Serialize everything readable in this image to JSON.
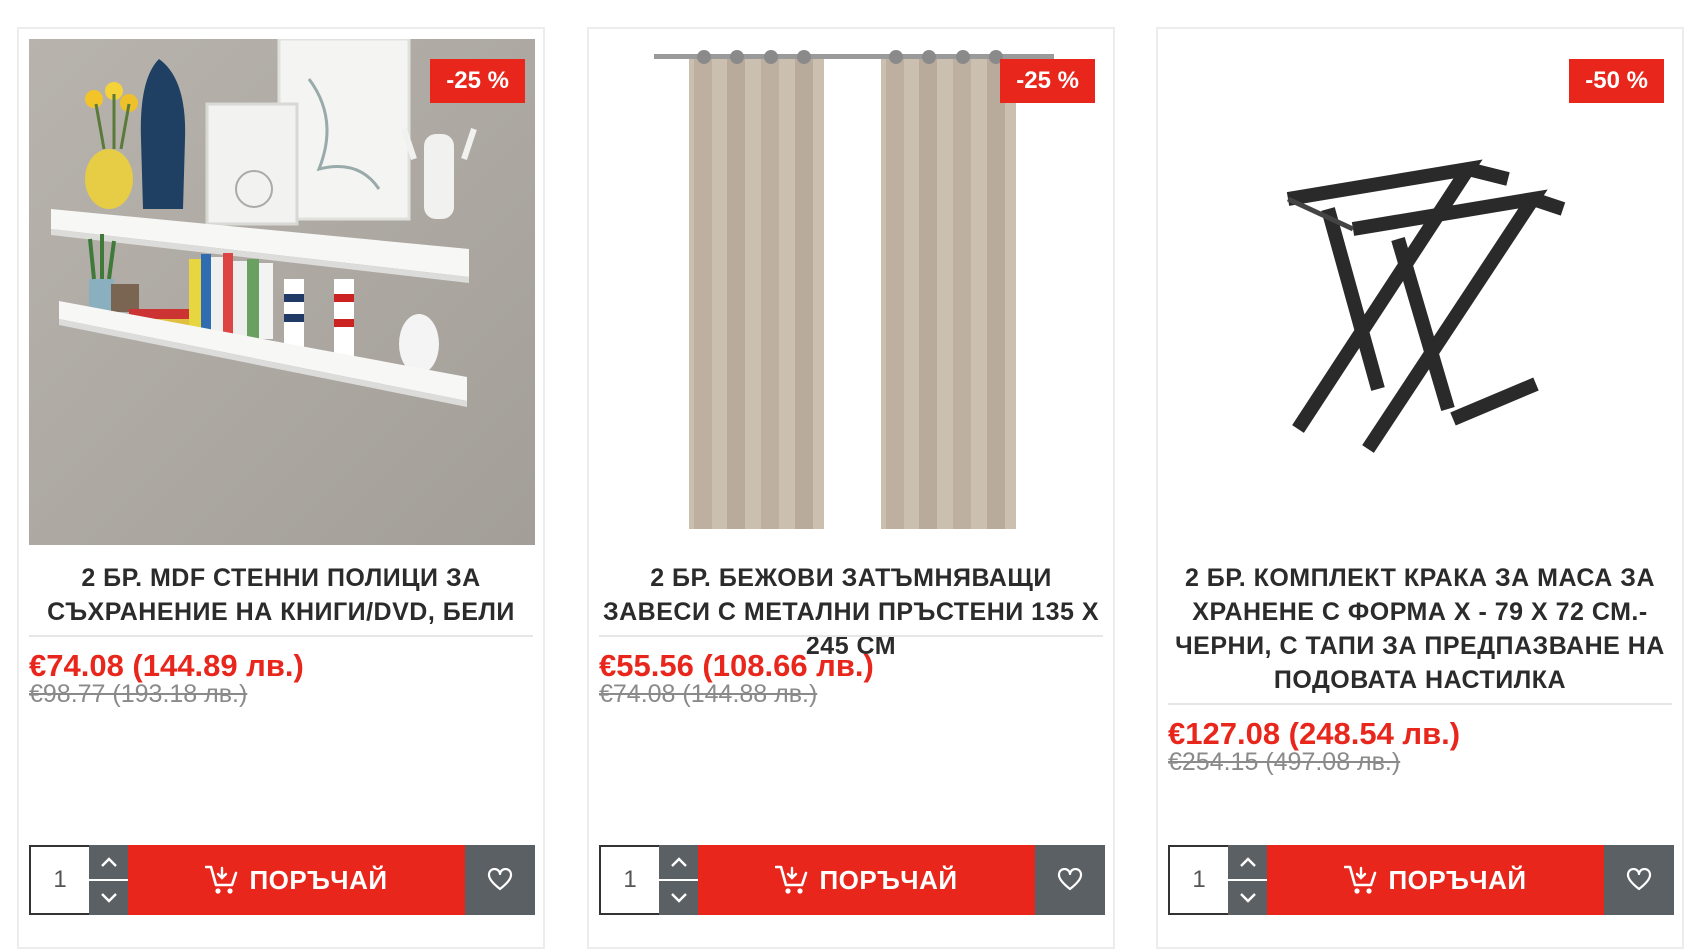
{
  "colors": {
    "accent": "#e8261c",
    "stepper": "#5b6064",
    "text": "#2b2b2b",
    "old_price": "#8a8a8a"
  },
  "products": [
    {
      "badge": "-25 %",
      "title": "2 бр. MDF стенни полици за съхранение на книги/DVD, бели",
      "price_new": "€74.08 (144.89 лв.)",
      "price_old": "€98.77 (193.18 лв.)",
      "quantity": "1",
      "order_label": "ПОРЪЧАЙ",
      "image_icon": "wall-shelves-image"
    },
    {
      "badge": "-25 %",
      "title": "2 бр. бежови затъмняващи завеси с метални пръстени 135 x 245 см",
      "price_new": "€55.56 (108.66 лв.)",
      "price_old": "€74.08 (144.88 лв.)",
      "quantity": "1",
      "order_label": "ПОРЪЧАЙ",
      "image_icon": "curtains-image"
    },
    {
      "badge": "-50 %",
      "title": "2 бр. комплект крака за маса за хранене с форма X - 79 x 72 см.- черни, с тапи за предпазване на подовата настилка",
      "price_new": "€127.08 (248.54 лв.)",
      "price_old": "€254.15 (497.08 лв.)",
      "quantity": "1",
      "order_label": "ПОРЪЧАЙ",
      "image_icon": "table-legs-image"
    }
  ]
}
